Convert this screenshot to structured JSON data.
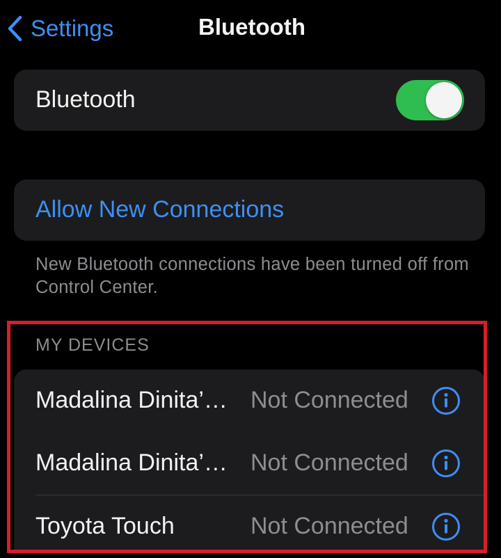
{
  "colors": {
    "background": "#000000",
    "card": "#1c1c1e",
    "accent": "#3d8ff5",
    "toggle_on": "#2fbd4f",
    "secondary_text": "#8d8d92",
    "highlight_border": "#d81e2a"
  },
  "nav": {
    "back_icon": "chevron-left-icon",
    "back_label": "Settings",
    "title": "Bluetooth"
  },
  "bluetooth": {
    "label": "Bluetooth",
    "enabled": true
  },
  "allow": {
    "label": "Allow New Connections",
    "footnote": "New Bluetooth connections have been turned off from Control Center."
  },
  "my_devices": {
    "header": "MY DEVICES",
    "info_icon": "info-circle-icon",
    "items": [
      {
        "name": "Madalina Dinita’…",
        "status": "Not Connected"
      },
      {
        "name": "Madalina Dinita’…",
        "status": "Not Connected"
      },
      {
        "name": "Toyota Touch",
        "status": "Not Connected"
      }
    ]
  }
}
